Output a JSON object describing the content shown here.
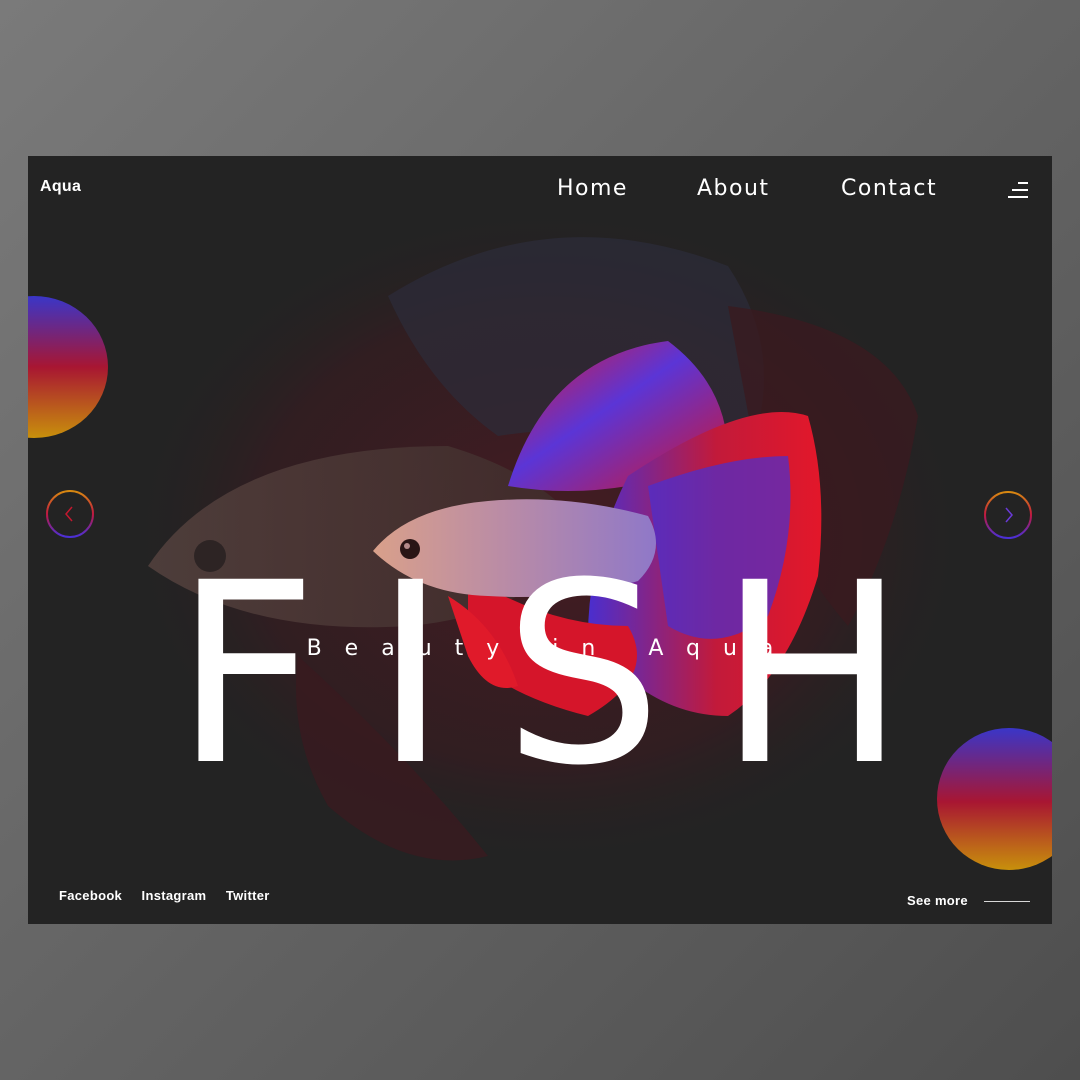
{
  "brand": {
    "name": "Aqua"
  },
  "nav": {
    "items": [
      {
        "label": "Home"
      },
      {
        "label": "About"
      },
      {
        "label": "Contact"
      }
    ],
    "menu_icon": "hamburger-menu-icon"
  },
  "hero": {
    "title": "FISH",
    "subtitle": "Beauty in Aqua"
  },
  "carousel": {
    "prev_icon": "chevron-left-icon",
    "next_icon": "chevron-right-icon"
  },
  "footer": {
    "social": [
      {
        "label": "Facebook"
      },
      {
        "label": "Instagram"
      },
      {
        "label": "Twitter"
      }
    ],
    "see_more": "See more"
  },
  "colors": {
    "page_background": "#6a6a6a",
    "frame_background": "#232323",
    "text": "#ffffff",
    "gradient_blue": "#3a36c8",
    "gradient_red": "#a81632",
    "gradient_gold": "#c8900c",
    "fish_red": "#e01a2a",
    "fish_blue": "#4b2fd0"
  }
}
